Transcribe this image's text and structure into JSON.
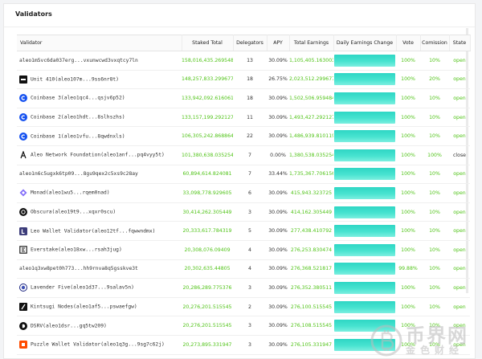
{
  "panel": {
    "title": "Validators"
  },
  "columns": [
    "Validator",
    "Staked Total",
    "Delegators",
    "APY",
    "Total Earnings",
    "Daily Earnings Change",
    "Vote",
    "Comission",
    "State"
  ],
  "rows": [
    {
      "icon": "",
      "validator": "aleo1m5vc6da037erg...vxunwcwd3vxqtcy7ln",
      "staked": "158,016,435.269548",
      "delegators": "13",
      "apy": "30.09%",
      "earnings": "1,105,405.163003",
      "daily_fill": 1,
      "vote": "100%",
      "commission": "10%",
      "state": "open",
      "state_color": "#52c41a"
    },
    {
      "icon": "unit410-icon",
      "validator": "Unit 410(aleo107m...9ss6nr8t)",
      "staked": "148,257,833.299677",
      "delegators": "18",
      "apy": "26.75%",
      "earnings": "2,023,512.299677",
      "daily_fill": 1,
      "vote": "100%",
      "commission": "20%",
      "state": "open",
      "state_color": "#52c41a"
    },
    {
      "icon": "coinbase-icon",
      "validator": "Coinbase 3(aleo1qc4...qsjv6p52)",
      "staked": "133,942,092.616061",
      "delegators": "18",
      "apy": "30.09%",
      "earnings": "1,502,506.959484",
      "daily_fill": 1,
      "vote": "100%",
      "commission": "10%",
      "state": "open",
      "state_color": "#52c41a"
    },
    {
      "icon": "coinbase-icon",
      "validator": "Coinbase 2(aleo1hdt...8slhszhs)",
      "staked": "133,157,199.292127",
      "delegators": "11",
      "apy": "30.09%",
      "earnings": "1,493,427.292127",
      "daily_fill": 1,
      "vote": "100%",
      "commission": "10%",
      "state": "open",
      "state_color": "#52c41a"
    },
    {
      "icon": "coinbase-icon",
      "validator": "Coinbase 1(aleo1vfu...8qwdnxls)",
      "staked": "106,305,242.868864",
      "delegators": "22",
      "apy": "30.09%",
      "earnings": "1,486,939.810119",
      "daily_fill": 1,
      "vote": "100%",
      "commission": "10%",
      "state": "open",
      "state_color": "#52c41a"
    },
    {
      "icon": "aleo-foundation-icon",
      "validator": "Aleo Network Foundation(aleo1anf...pq4vyy5t)",
      "staked": "101,380,638.035254",
      "delegators": "7",
      "apy": "0.00%",
      "earnings": "1,380,538.035254",
      "daily_fill": 1,
      "vote": "100%",
      "commission": "100%",
      "state": "close",
      "state_color": "#333333"
    },
    {
      "icon": "",
      "validator": "aleo1n6c5ugxk6tp09...8gu9qex2c5xs9c28ay",
      "staked": "60,894,614.824081",
      "delegators": "7",
      "apy": "33.44%",
      "earnings": "1,735,367.706156",
      "daily_fill": 1,
      "vote": "100%",
      "commission": "10%",
      "state": "open",
      "state_color": "#52c41a"
    },
    {
      "icon": "monad-icon",
      "validator": "Monad(aleo1wu5...rqem0nad)",
      "staked": "33,098,778.929605",
      "delegators": "6",
      "apy": "30.09%",
      "earnings": "415,943.323725",
      "daily_fill": 1,
      "vote": "100%",
      "commission": "10%",
      "state": "open",
      "state_color": "#52c41a"
    },
    {
      "icon": "obscura-icon",
      "validator": "Obscura(aleo19t9...xqxr0scu)",
      "staked": "30,414,262.305449",
      "delegators": "3",
      "apy": "30.09%",
      "earnings": "414,162.305449",
      "daily_fill": 1,
      "vote": "100%",
      "commission": "10%",
      "state": "open",
      "state_color": "#52c41a"
    },
    {
      "icon": "leo-wallet-icon",
      "validator": "Leo Wallet Validator(aleo12tf...fqwwndmx)",
      "staked": "20,333,617.784319",
      "delegators": "5",
      "apy": "30.09%",
      "earnings": "277,438.410792",
      "daily_fill": 1,
      "vote": "100%",
      "commission": "10%",
      "state": "open",
      "state_color": "#52c41a"
    },
    {
      "icon": "everstake-icon",
      "validator": "Everstake(aleo18xw...rsah3jug)",
      "staked": "20,308,076.09409",
      "delegators": "4",
      "apy": "30.09%",
      "earnings": "276,253.830474",
      "daily_fill": 1,
      "vote": "100%",
      "commission": "10%",
      "state": "open",
      "state_color": "#52c41a"
    },
    {
      "icon": "",
      "validator": "aleo1q3xw8pet0h773...hh9rnva8q5gsskve3t",
      "staked": "20,302,635.44805",
      "delegators": "4",
      "apy": "30.09%",
      "earnings": "276,368.521817",
      "daily_fill": 1,
      "vote": "99.88%",
      "commission": "10%",
      "state": "open",
      "state_color": "#52c41a"
    },
    {
      "icon": "lavender-icon",
      "validator": "Lavender Five(aleo1d37...9salav5n)",
      "staked": "20,286,289.775376",
      "delegators": "3",
      "apy": "30.09%",
      "earnings": "276,352.380511",
      "daily_fill": 1,
      "vote": "100%",
      "commission": "10%",
      "state": "open",
      "state_color": "#52c41a"
    },
    {
      "icon": "kintsugi-icon",
      "validator": "Kintsugi Nodes(aleo1af5...pswaefgw)",
      "staked": "20,276,201.515545",
      "delegators": "2",
      "apy": "30.09%",
      "earnings": "276,100.515545",
      "daily_fill": 1,
      "vote": "100%",
      "commission": "10%",
      "state": "open",
      "state_color": "#52c41a"
    },
    {
      "icon": "dsrv-icon",
      "validator": "DSRV(aleo1dsr...gq5tw209)",
      "staked": "20,276,201.515545",
      "delegators": "3",
      "apy": "30.09%",
      "earnings": "276,108.515545",
      "daily_fill": 1,
      "vote": "100%",
      "commission": "10%",
      "state": "open",
      "state_color": "#52c41a"
    },
    {
      "icon": "puzzle-wallet-icon",
      "validator": "Puzzle Wallet Validator(aleo1q3g...9sg7c62j)",
      "staked": "20,273,895.331947",
      "delegators": "3",
      "apy": "30.09%",
      "earnings": "276,105.331947",
      "daily_fill": 1,
      "vote": "100%",
      "commission": "10%",
      "state": "open",
      "state_color": "#52c41a"
    }
  ],
  "watermark": {
    "line1": "币界网",
    "line2": "金色财经"
  },
  "colors": {
    "accent_green": "#52c41a",
    "bar": "#3ddcc9",
    "close": "#333333"
  }
}
